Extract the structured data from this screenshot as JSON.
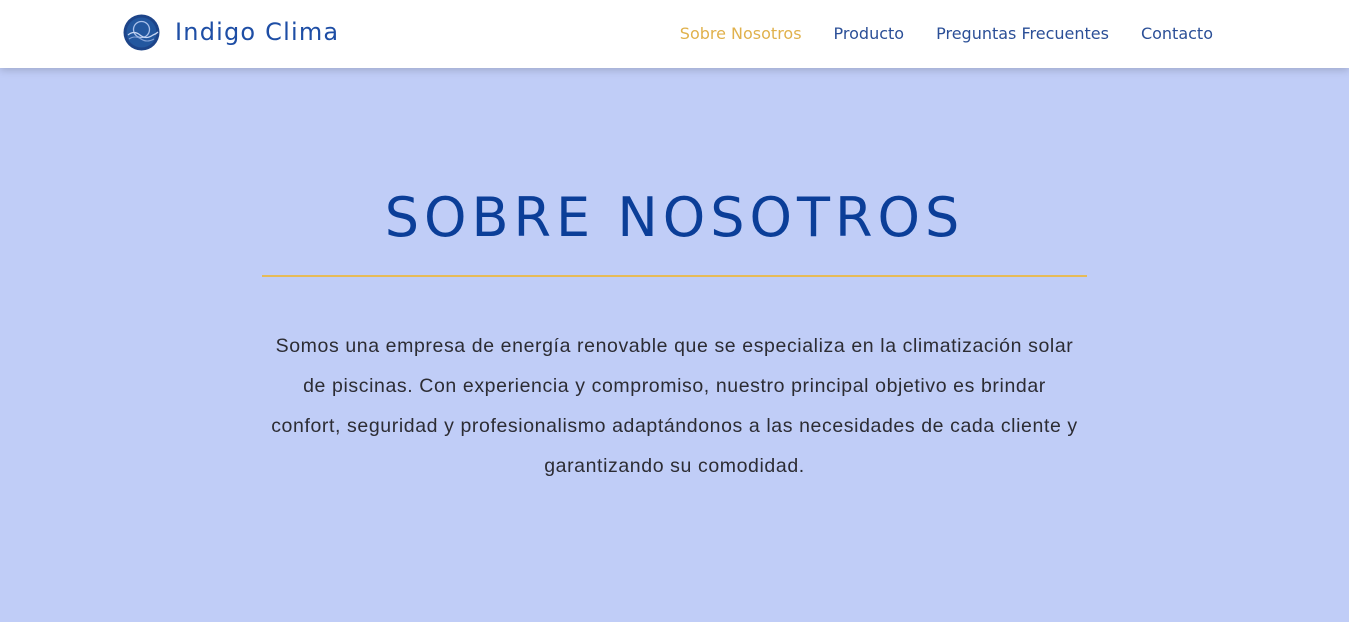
{
  "colors": {
    "page_background": "#c0cdf7",
    "navbar_background": "#ffffff",
    "brand_text": "#1e4ea5",
    "nav_link": "#2b4f97",
    "nav_link_active": "#e0b14c",
    "heading": "#0b3e98",
    "divider": "#e6bb57",
    "body_text": "#2c2c33"
  },
  "header": {
    "logo_icon": "indigo-clima-logo-icon",
    "brand_name": "Indigo Clima",
    "nav": {
      "items": [
        {
          "label": "Sobre Nosotros",
          "active": true
        },
        {
          "label": "Producto",
          "active": false
        },
        {
          "label": "Preguntas Frecuentes",
          "active": false
        },
        {
          "label": "Contacto",
          "active": false
        }
      ]
    }
  },
  "about": {
    "title": "SOBRE NOSOTROS",
    "text": "Somos una empresa de energía renovable que se especializa en la climatización solar de piscinas. Con experiencia y compromiso, nuestro principal objetivo es brindar confort, seguridad y profesionalismo adaptándonos a las necesidades de cada cliente y garantizando su comodidad."
  }
}
